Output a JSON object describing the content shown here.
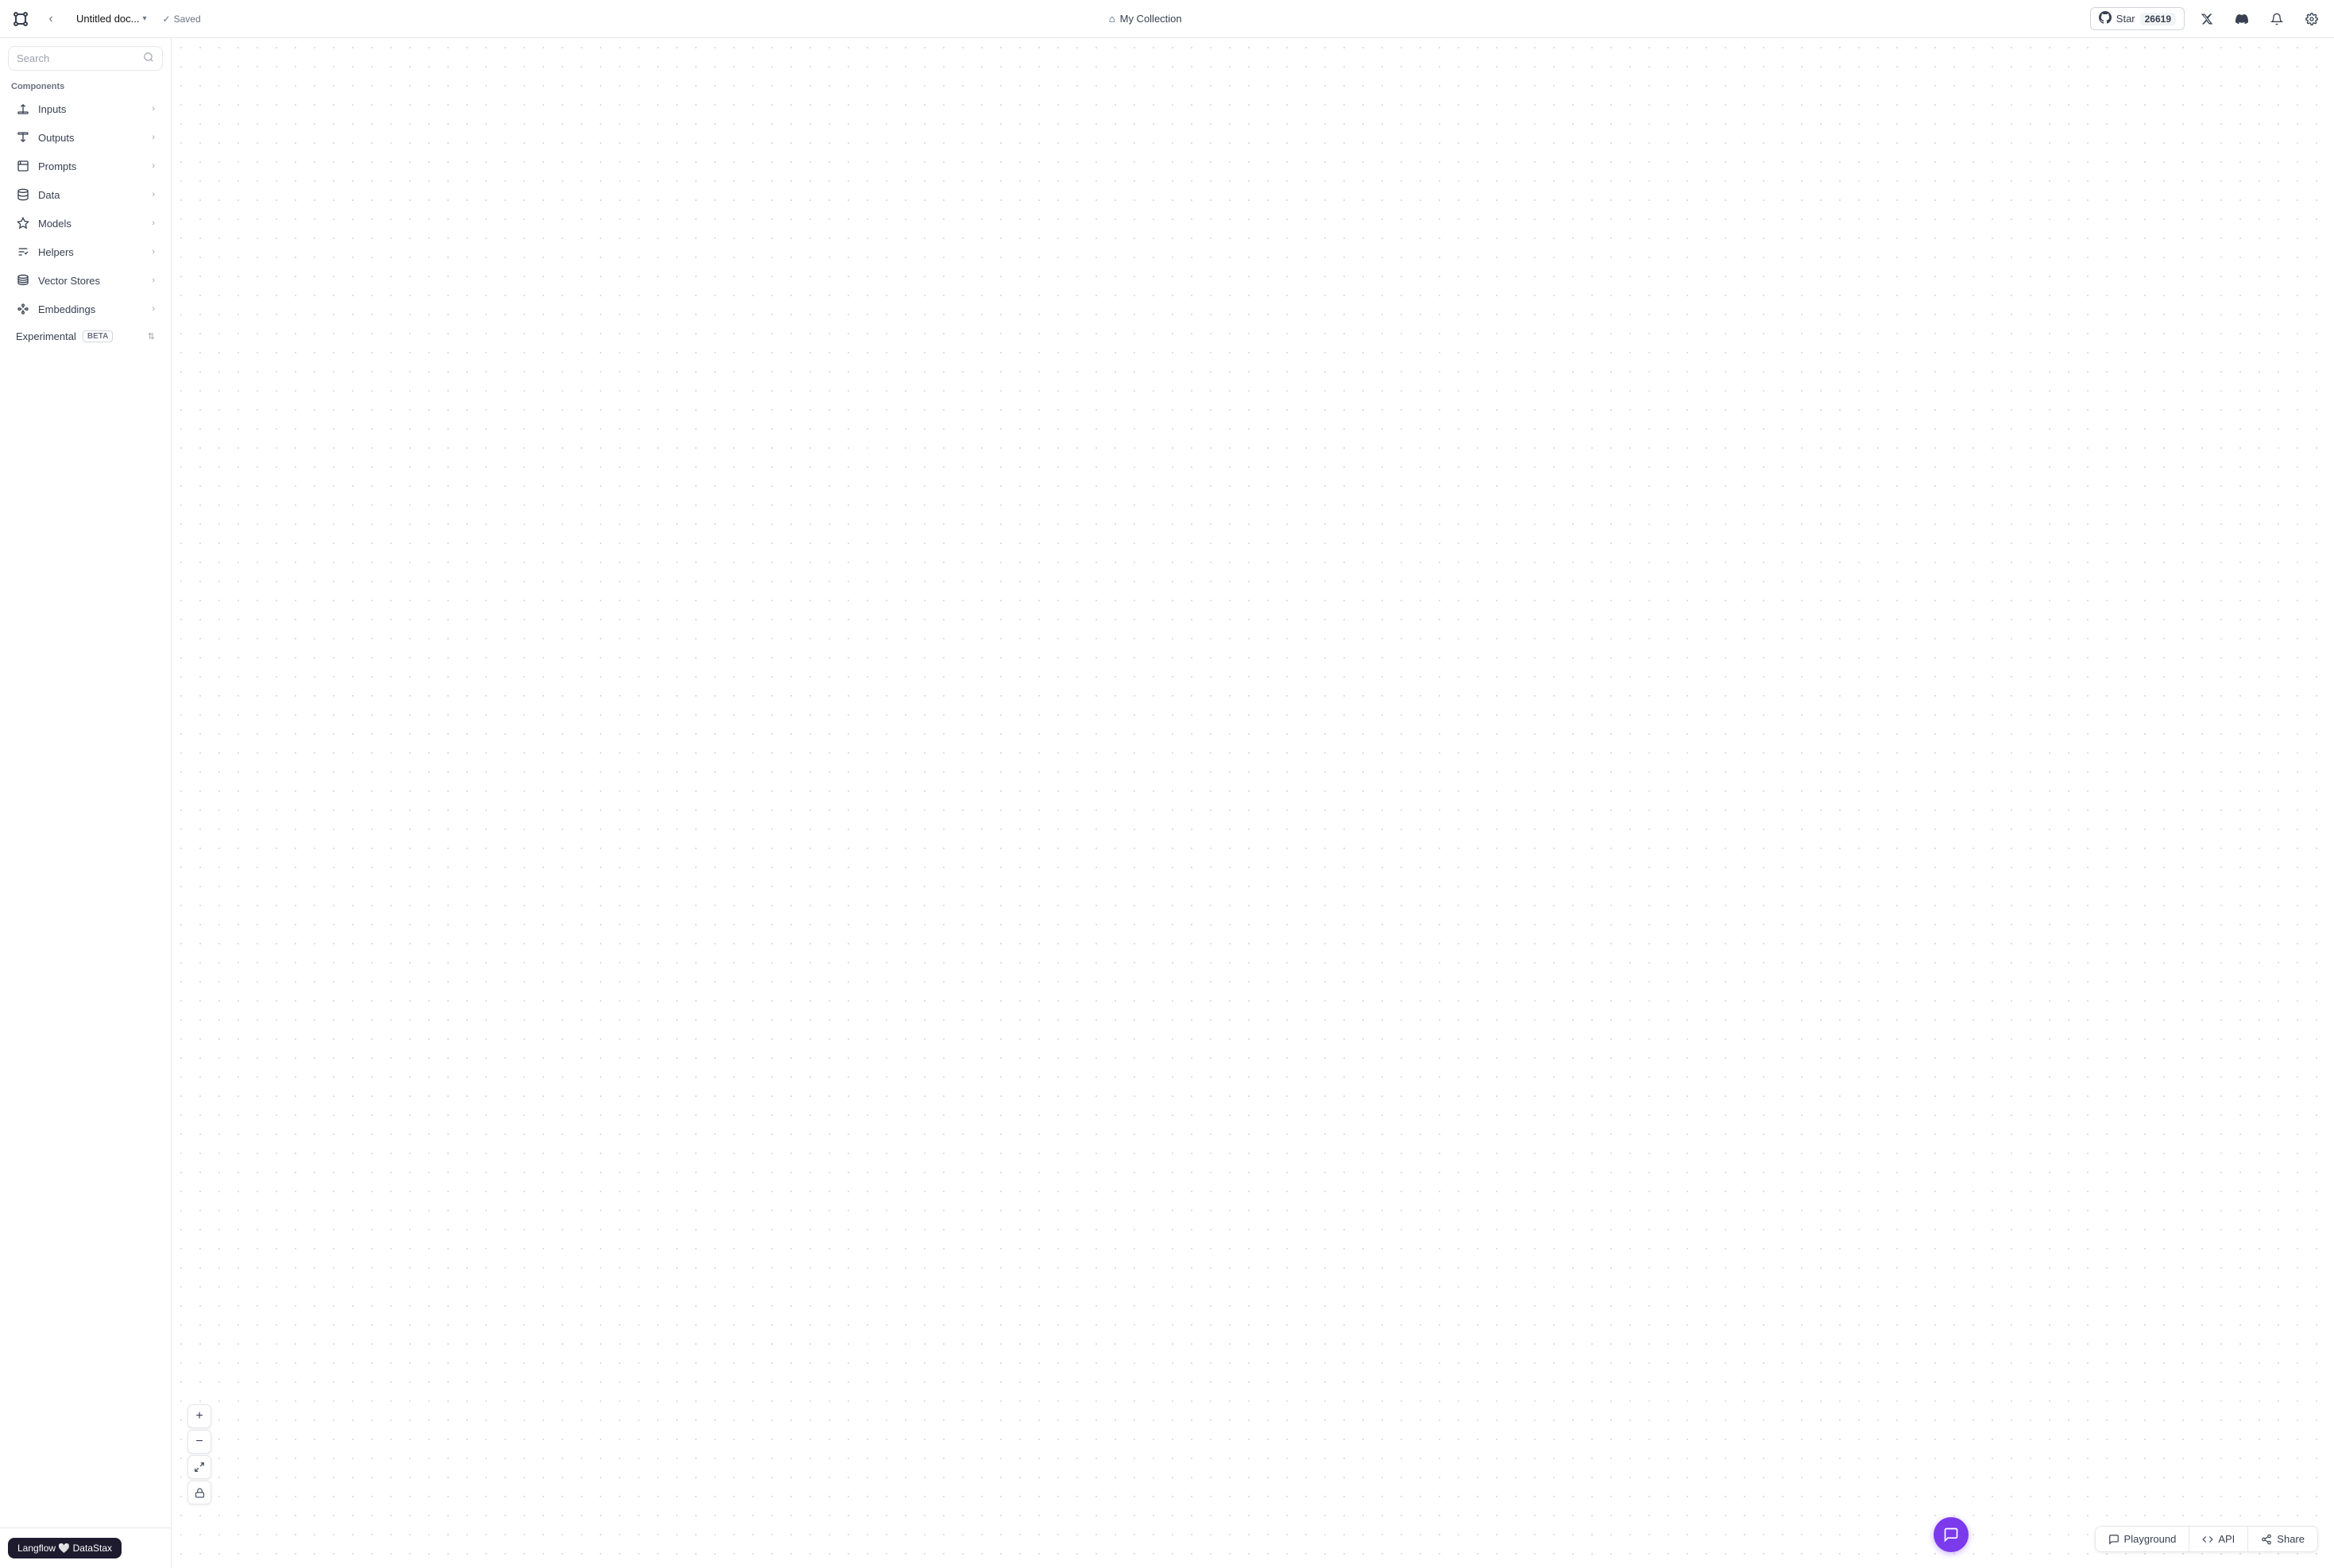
{
  "header": {
    "doc_title": "Untitled doc...",
    "saved_label": "Saved",
    "collection_label": "My Collection",
    "star_label": "Star",
    "star_count": "26619",
    "settings_icon": "⚙",
    "bell_icon": "🔔",
    "x_icon": "✕",
    "discord_icon": "💬"
  },
  "sidebar": {
    "search_placeholder": "Search",
    "components_label": "Components",
    "nav_items": [
      {
        "id": "inputs",
        "label": "Inputs"
      },
      {
        "id": "outputs",
        "label": "Outputs"
      },
      {
        "id": "prompts",
        "label": "Prompts"
      },
      {
        "id": "data",
        "label": "Data"
      },
      {
        "id": "models",
        "label": "Models"
      },
      {
        "id": "helpers",
        "label": "Helpers"
      },
      {
        "id": "vector-stores",
        "label": "Vector Stores"
      },
      {
        "id": "embeddings",
        "label": "Embeddings"
      }
    ],
    "experimental_label": "Experimental",
    "beta_label": "BETA",
    "footer_label": "Langflow 🤍 DataStax"
  },
  "zoom": {
    "zoom_in": "+",
    "zoom_out": "−",
    "fit": "⤢",
    "lock": "🔒"
  },
  "bottom_actions": [
    {
      "id": "playground",
      "label": "Playground"
    },
    {
      "id": "api",
      "label": "API"
    },
    {
      "id": "share",
      "label": "Share"
    }
  ]
}
